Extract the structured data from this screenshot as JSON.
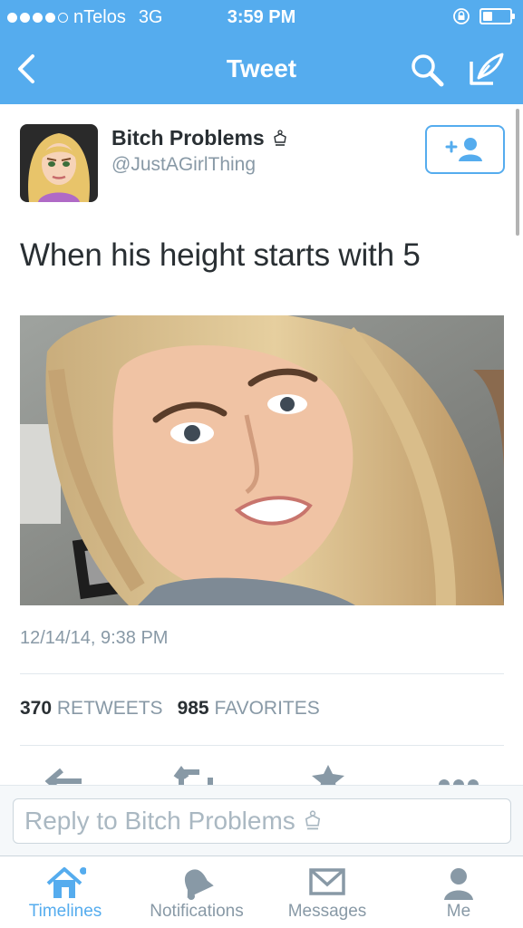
{
  "status_bar": {
    "carrier": "nTelos",
    "network": "3G",
    "time": "3:59 PM"
  },
  "nav": {
    "title": "Tweet"
  },
  "tweet": {
    "author_name": "Bitch Problems",
    "author_handle": "@JustAGirlThing",
    "text": "When his height starts with 5",
    "timestamp": "12/14/14, 9:38 PM",
    "retweets_count": "370",
    "retweets_label": "RETWEETS",
    "favorites_count": "985",
    "favorites_label": "FAVORITES"
  },
  "reply": {
    "placeholder": "Reply to Bitch Problems"
  },
  "tabs": [
    {
      "label": "Timelines",
      "icon": "home-icon",
      "active": true
    },
    {
      "label": "Notifications",
      "icon": "bell-icon",
      "active": false
    },
    {
      "label": "Messages",
      "icon": "envelope-icon",
      "active": false
    },
    {
      "label": "Me",
      "icon": "person-icon",
      "active": false
    }
  ],
  "colors": {
    "brand": "#55acee",
    "text": "#292f33",
    "muted": "#8899a6"
  }
}
